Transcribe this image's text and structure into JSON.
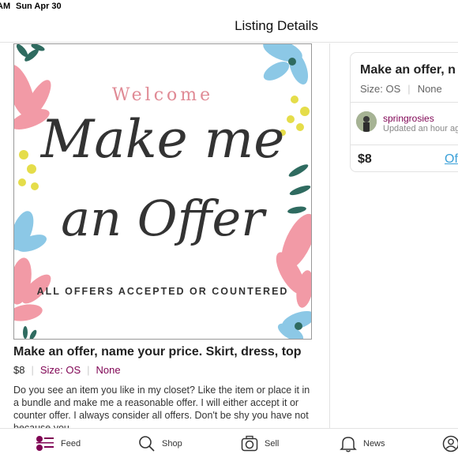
{
  "status_bar": {
    "time": "AM",
    "date": "Sun Apr 30"
  },
  "header": {
    "title": "Listing Details"
  },
  "image": {
    "welcome": "Welcome",
    "line1": "Make me",
    "line2": "an Offer",
    "tagline": "ALL OFFERS ACCEPTED OR COUNTERED"
  },
  "listing": {
    "title": "Make an offer, name your price. Skirt, dress, top",
    "price": "$8",
    "size": "Size: OS",
    "brand": "None",
    "description": "Do you see an item you like in my closet? Like the item or place it in a bundle and make me a reasonable offer.  I will either accept it or counter offer. I always consider all offers. Don't be shy you have not because you"
  },
  "card": {
    "title": "Make an offer, n",
    "size": "Size: OS",
    "brand": "None",
    "seller": "springrosies",
    "updated": "Updated an hour ag",
    "price": "$8",
    "offer_label": "Of"
  },
  "tabs": [
    {
      "label": "Feed",
      "icon": "feed-icon"
    },
    {
      "label": "Shop",
      "icon": "search-icon"
    },
    {
      "label": "Sell",
      "icon": "camera-icon"
    },
    {
      "label": "News",
      "icon": "bell-icon"
    },
    {
      "label": "",
      "icon": "profile-icon"
    }
  ],
  "colors": {
    "brand": "#7f0353",
    "link": "#3aa0d8",
    "pink_flower": "#f29aa6",
    "blue_flower": "#8cc8e6",
    "leaf": "#2f6b60",
    "yellow": "#e5dd4a"
  }
}
